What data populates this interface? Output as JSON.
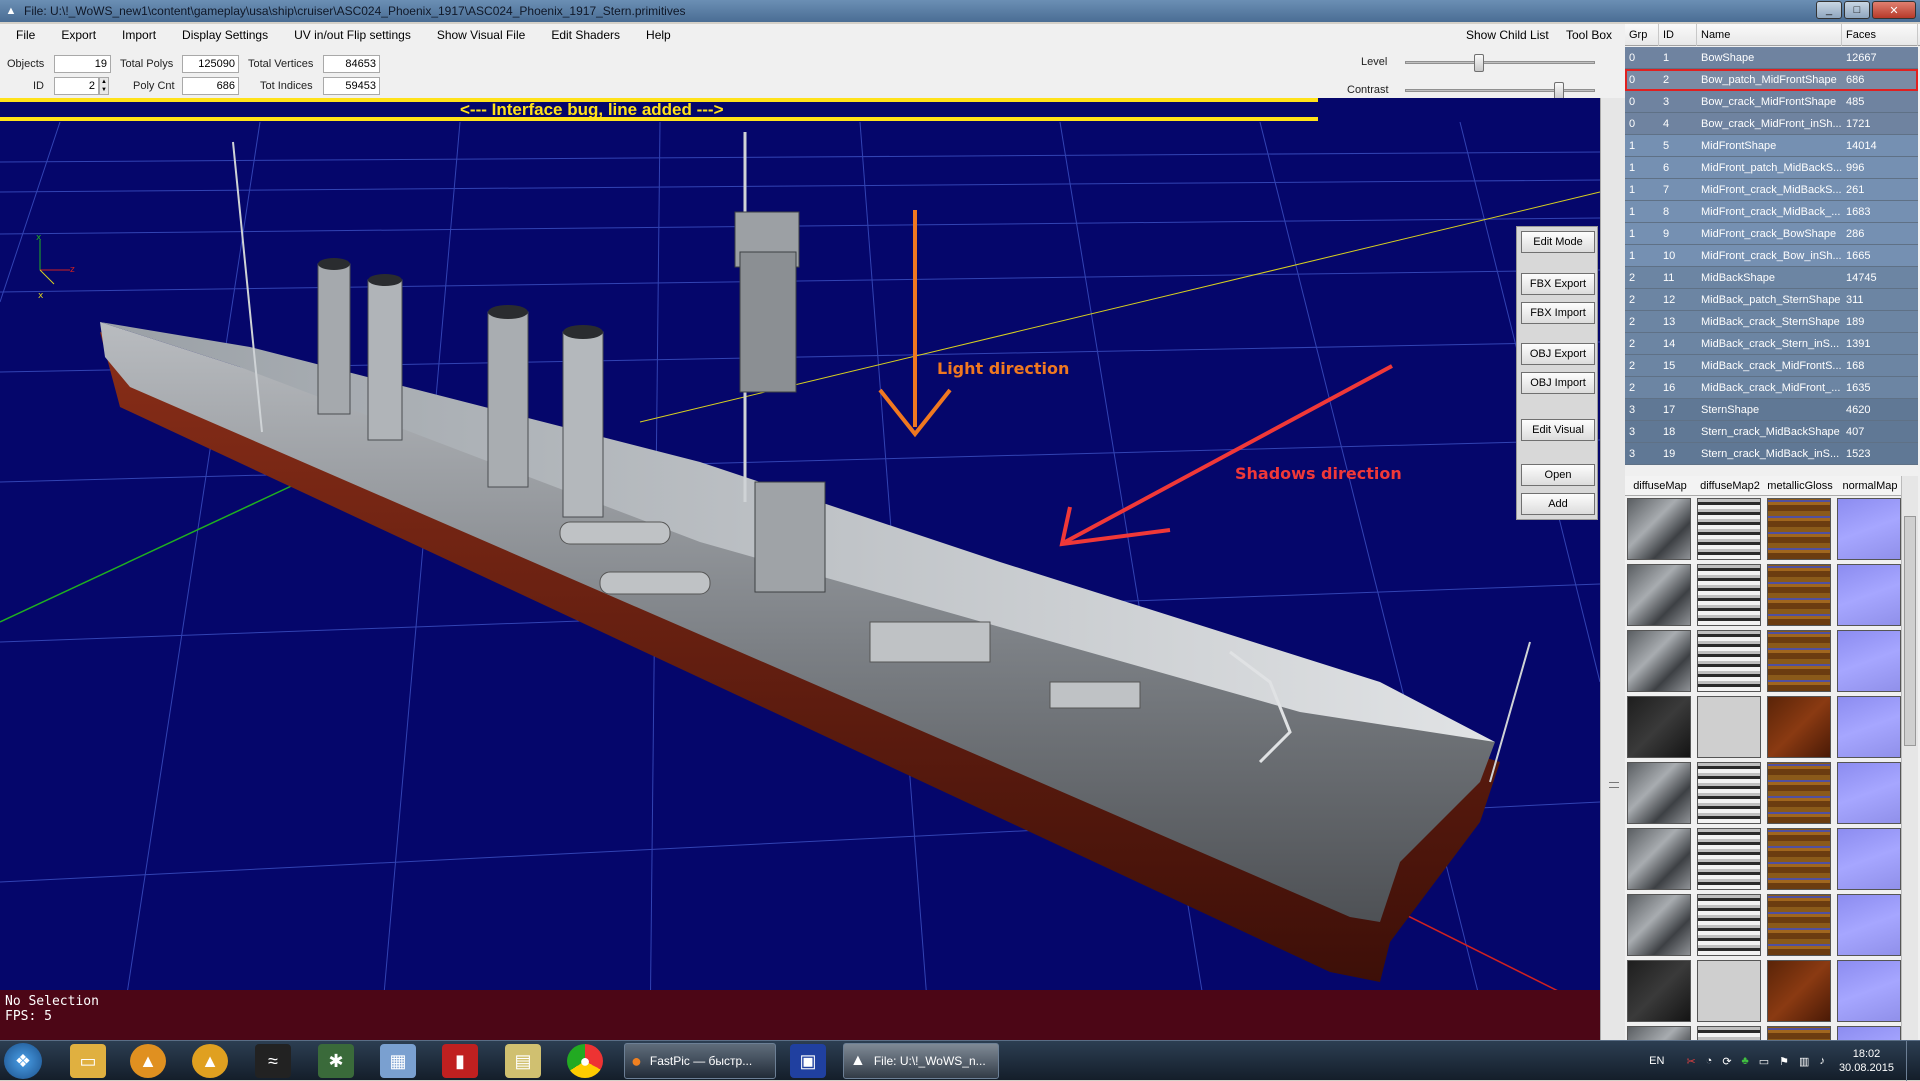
{
  "window": {
    "title": "File: U:\\!_WoWS_new1\\content\\gameplay\\usa\\ship\\cruiser\\ASC024_Phoenix_1917\\ASC024_Phoenix_1917_Stern.primitives",
    "min": "_",
    "max": "□",
    "close": "✕"
  },
  "menu": {
    "items": [
      "File",
      "Export",
      "Import",
      "Display Settings",
      "UV in/out Flip settings",
      "Show Visual File",
      "Edit Shaders",
      "Help"
    ],
    "show_child_list": "Show Child List",
    "tool_box": "Tool Box"
  },
  "stats": {
    "objects_label": "Objects",
    "objects_value": "19",
    "id_label": "ID",
    "id_value": "2",
    "total_polys_label": "Total Polys",
    "total_polys_value": "125090",
    "poly_cnt_label": "Poly Cnt",
    "poly_cnt_value": "686",
    "total_vertices_label": "Total Vertices",
    "total_vertices_value": "84653",
    "tot_indices_label": "Tot Indices",
    "tot_indices_value": "59453",
    "level_label": "Level",
    "level_value": 0.38,
    "contrast_label": "Contrast",
    "contrast_value": 0.82
  },
  "annotations": {
    "interface_bug": "<--- Interface bug, line added --->",
    "light_direction": "Light direction",
    "shadows_direction": "Shadows direction",
    "colors": {
      "bug": "#ffe21a",
      "light": "#f07820",
      "shadow": "#f03838"
    }
  },
  "tools": {
    "edit_mode": "Edit Mode",
    "fbx_export": "FBX Export",
    "fbx_import": "FBX Import",
    "obj_export": "OBJ Export",
    "obj_import": "OBJ Import",
    "edit_visual": "Edit Visual",
    "open": "Open",
    "add": "Add"
  },
  "status": {
    "line1": "No Selection",
    "line2": "FPS: 5"
  },
  "table": {
    "headers": [
      "Grp",
      "ID",
      "Name",
      "Faces"
    ],
    "rows": [
      {
        "grp": "0",
        "id": "1",
        "name": "BowShape",
        "faces": "12667"
      },
      {
        "grp": "0",
        "id": "2",
        "name": "Bow_patch_MidFrontShape",
        "faces": "686"
      },
      {
        "grp": "0",
        "id": "3",
        "name": "Bow_crack_MidFrontShape",
        "faces": "485"
      },
      {
        "grp": "0",
        "id": "4",
        "name": "Bow_crack_MidFront_inSh...",
        "faces": "1721"
      },
      {
        "grp": "1",
        "id": "5",
        "name": "MidFrontShape",
        "faces": "14014"
      },
      {
        "grp": "1",
        "id": "6",
        "name": "MidFront_patch_MidBackS...",
        "faces": "996"
      },
      {
        "grp": "1",
        "id": "7",
        "name": "MidFront_crack_MidBackS...",
        "faces": "261"
      },
      {
        "grp": "1",
        "id": "8",
        "name": "MidFront_crack_MidBack_...",
        "faces": "1683"
      },
      {
        "grp": "1",
        "id": "9",
        "name": "MidFront_crack_BowShape",
        "faces": "286"
      },
      {
        "grp": "1",
        "id": "10",
        "name": "MidFront_crack_Bow_inSh...",
        "faces": "1665"
      },
      {
        "grp": "2",
        "id": "11",
        "name": "MidBackShape",
        "faces": "14745"
      },
      {
        "grp": "2",
        "id": "12",
        "name": "MidBack_patch_SternShape",
        "faces": "311"
      },
      {
        "grp": "2",
        "id": "13",
        "name": "MidBack_crack_SternShape",
        "faces": "189"
      },
      {
        "grp": "2",
        "id": "14",
        "name": "MidBack_crack_Stern_inS...",
        "faces": "1391"
      },
      {
        "grp": "2",
        "id": "15",
        "name": "MidBack_crack_MidFrontS...",
        "faces": "168"
      },
      {
        "grp": "2",
        "id": "16",
        "name": "MidBack_crack_MidFront_...",
        "faces": "1635"
      },
      {
        "grp": "3",
        "id": "17",
        "name": "SternShape",
        "faces": "4620"
      },
      {
        "grp": "3",
        "id": "18",
        "name": "Stern_crack_MidBackShape",
        "faces": "407"
      },
      {
        "grp": "3",
        "id": "19",
        "name": "Stern_crack_MidBack_inS...",
        "faces": "1523"
      }
    ]
  },
  "textures": {
    "headers": [
      "diffuseMap",
      "diffuseMap2",
      "metallicGloss",
      "normalMap"
    ]
  },
  "taskbar": {
    "firefox_label": "FastPic — быстр...",
    "app_label": "File: U:\\!_WoWS_n...",
    "lang": "EN",
    "time": "18:02",
    "date": "30.08.2015"
  }
}
